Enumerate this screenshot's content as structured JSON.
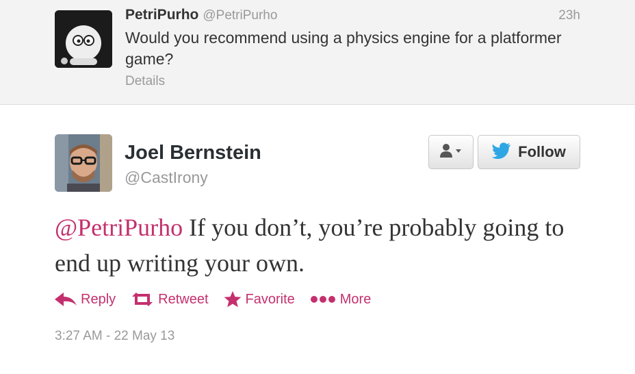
{
  "parent_tweet": {
    "name": "PetriPurho",
    "handle": "@PetriPurho",
    "time": "23h",
    "text": "Would you recommend using a physics engine for a platformer game?",
    "details_label": "Details"
  },
  "tweet": {
    "name": "Joel Bernstein",
    "handle": "@CastIrony",
    "mention": "@PetriPurho",
    "text": " If you don’t, you’re probably going to end up writing your own.",
    "timestamp": "3:27 AM - 22 May 13"
  },
  "buttons": {
    "follow_label": "Follow"
  },
  "actions": {
    "reply": "Reply",
    "retweet": "Retweet",
    "favorite": "Favorite",
    "more": "More"
  },
  "colors": {
    "accent": "#c4306e",
    "twitter_blue": "#2ea6e4",
    "muted": "#999999"
  },
  "icons": {
    "user": "user-dropdown-icon",
    "bird": "twitter-bird-icon",
    "reply": "reply-arrow-icon",
    "retweet": "retweet-icon",
    "favorite": "star-icon",
    "more": "more-dots-icon"
  }
}
